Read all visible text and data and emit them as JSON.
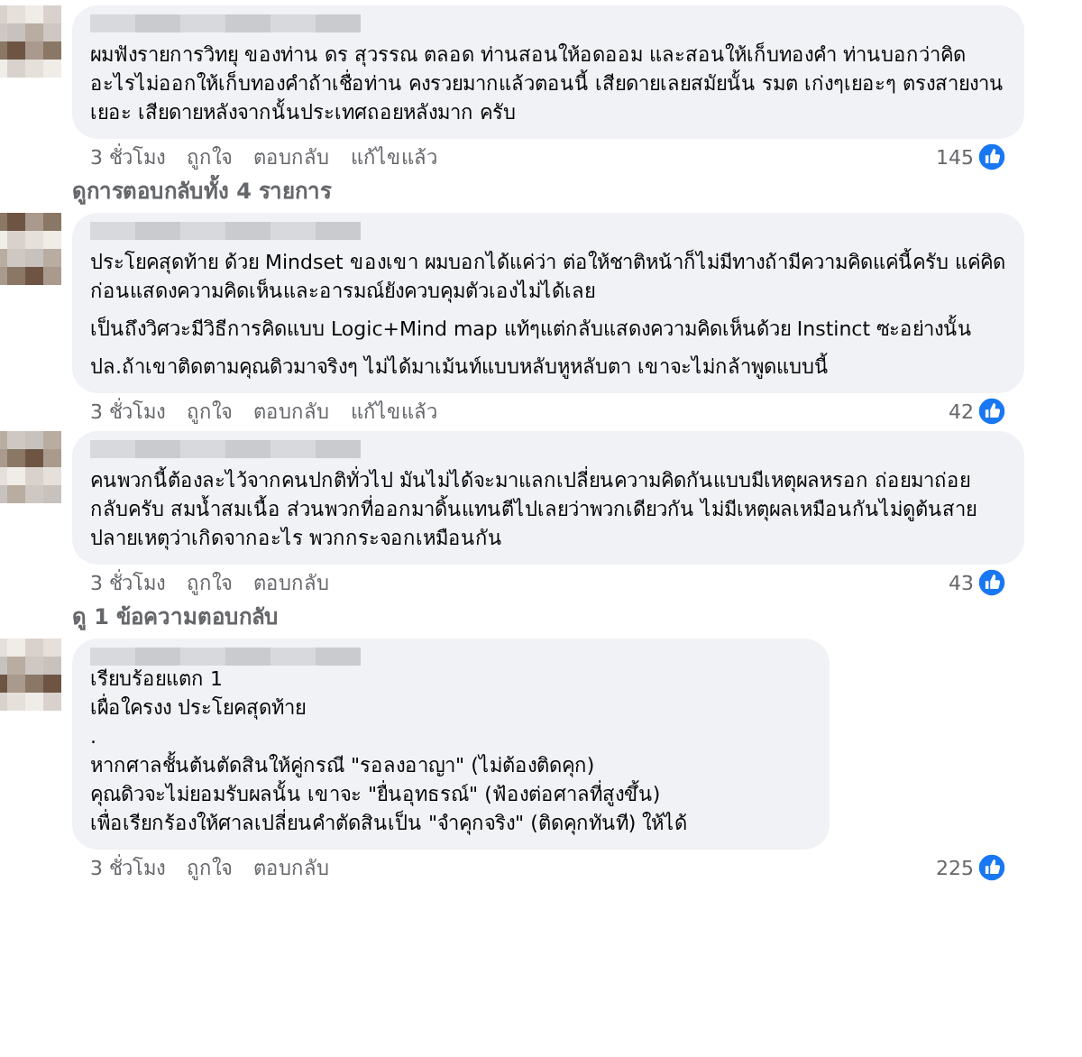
{
  "comments": [
    {
      "paragraphs": [
        "ผมฟังรายการวิทยุ ของท่าน ดร สุวรรณ ตลอด ท่านสอนให้อดออม และสอนให้เก็บทองคำ ท่านบอกว่าคิดอะไรไม่ออกให้เก็บทองคำถ้าเชื่อท่าน คงรวยมากแล้วตอนนี้ เสียดายเลยสมัยนั้น รมต เก่งๆเยอะๆ ตรงสายงานเยอะ เสียดายหลังจากนั้นประเทศถอยหลังมาก ครับ"
      ],
      "kind": "prose",
      "time": "3 ชั่วโมง",
      "actions": [
        "ถูกใจ",
        "ตอบกลับ",
        "แก้ไขแล้ว"
      ],
      "reactions": "145",
      "replies_link": "ดูการตอบกลับทั้ง 4 รายการ"
    },
    {
      "paragraphs": [
        "ประโยคสุดท้าย ด้วย Mindset ของเขา ผมบอกได้แค่ว่า ต่อให้ชาติหน้าก็ไม่มีทางถ้ามีความคิดแค่นี้ครับ แค่คิดก่อนแสดงความคิดเห็นและอารมณ์ยังควบคุมตัวเองไม่ได้เลย",
        "เป็นถึงวิศวะมีวิธีการคิดแบบ Logic+Mind map แท้ๆแต่กลับแสดงความคิดเห็นด้วย Instinct ซะอย่างนั้น",
        "ปล.ถ้าเขาติดตามคุณดิวมาจริงๆ ไม่ได้มาเม้นท์แบบหลับหูหลับตา เขาจะไม่กล้าพูดแบบนี้"
      ],
      "kind": "prose",
      "time": "3 ชั่วโมง",
      "actions": [
        "ถูกใจ",
        "ตอบกลับ",
        "แก้ไขแล้ว"
      ],
      "reactions": "42"
    },
    {
      "paragraphs": [
        "คนพวกนี้ต้องละไว้จากคนปกติทั่วไป มันไม่ได้จะมาแลกเปลี่ยนความคิดกันแบบมีเหตุผลหรอก ถ่อยมาถ่อยกลับครับ สมน้ำสมเนื้อ ส่วนพวกที่ออกมาดิ้นแทนตีไปเลยว่าพวกเดียวกัน ไม่มีเหตุผลเหมือนกันไม่ดูต้นสายปลายเหตุว่าเกิดจากอะไร พวกกระจอกเหมือนกัน"
      ],
      "kind": "prose",
      "time": "3 ชั่วโมง",
      "actions": [
        "ถูกใจ",
        "ตอบกลับ"
      ],
      "reactions": "43",
      "replies_link": "ดู 1 ข้อความตอบกลับ"
    },
    {
      "paragraphs": [
        "เรียบร้อยแตก 1",
        "เผื่อใครงง ประโยคสุดท้าย",
        ".",
        "หากศาลชั้นต้นตัดสินให้คู่กรณี \"รอลงอาญา\" (ไม่ต้องติดคุก)",
        "คุณดิวจะไม่ยอมรับผลนั้น เขาจะ \"ยื่นอุทธรณ์\" (ฟ้องต่อศาลที่สูงขึ้น)",
        "เพื่อเรียกร้องให้ศาลเปลี่ยนคำตัดสินเป็น \"จำคุกจริง\" (ติดคุกทันที) ให้ได้"
      ],
      "kind": "lines",
      "time": "3 ชั่วโมง",
      "actions": [
        "ถูกใจ",
        "ตอบกลับ"
      ],
      "reactions": "225"
    }
  ]
}
